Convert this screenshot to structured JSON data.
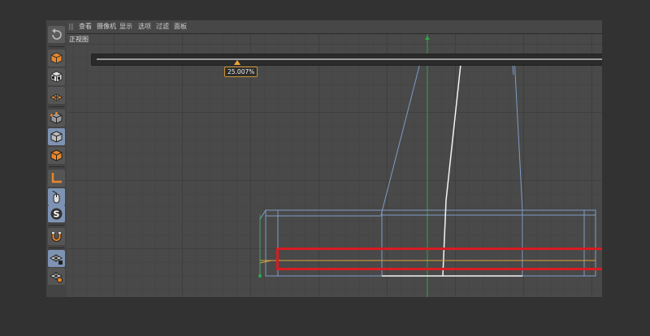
{
  "menubar": {
    "items": [
      "查看",
      "摄像机",
      "显示",
      "选项",
      "过滤",
      "面板"
    ]
  },
  "viewport": {
    "label": "正视图"
  },
  "slider": {
    "value_label": "25.007%",
    "value_percent": 25.007
  },
  "toolbar": {
    "icons": [
      "undo-icon",
      "cube-icon",
      "checker-cube-icon",
      "checker-plane-icon",
      "wire-cube-icon",
      "solid-cube-icon",
      "orange-cube-icon",
      "axis-icon",
      "mouse-icon",
      "s-icon",
      "magnet-icon",
      "grid-lock-icon",
      "grid-gear-icon"
    ]
  },
  "colors": {
    "accent_orange": "#f2a535",
    "highlight_red": "#d81c22",
    "wire_blue": "#7f9cc4",
    "axis_green": "#2fa84a"
  }
}
